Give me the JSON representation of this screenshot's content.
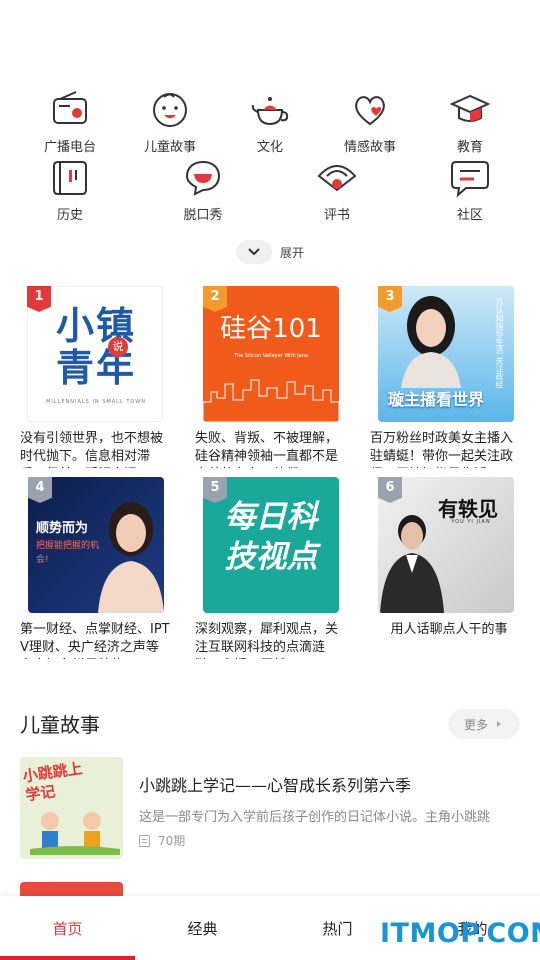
{
  "categories": [
    {
      "label": "广播电台",
      "icon": "radio-icon"
    },
    {
      "label": "儿童故事",
      "icon": "child-face-icon"
    },
    {
      "label": "文化",
      "icon": "teapot-icon"
    },
    {
      "label": "情感故事",
      "icon": "heart-icon"
    },
    {
      "label": "教育",
      "icon": "graduation-cap-icon"
    },
    {
      "label": "历史",
      "icon": "scroll-icon"
    },
    {
      "label": "脱口秀",
      "icon": "speech-bubble-icon"
    },
    {
      "label": "评书",
      "icon": "fan-icon"
    },
    {
      "label": "社区",
      "icon": "message-icon"
    }
  ],
  "expand_label": "展开",
  "cards": [
    {
      "rank": "1",
      "title": "没有引领世界，也不想被时代抛下。信息相对滞后，但并不孤陋寡闻。",
      "cover_text": "小镇青年",
      "cover_stamp": "说",
      "cover_sub": "MILLENNIALS IN SMALL TOWN"
    },
    {
      "rank": "2",
      "title": "失败、背叛、不被理解，硅谷精神领袖一直都不是完美的存在；他们",
      "cover_text": "硅谷101",
      "cover_sub": "The Silicon Valleyer With Jane"
    },
    {
      "rank": "3",
      "title": "百万粉丝时政美女主播入驻蜻蜓！带你一起关注政经，用认知指导生活",
      "cover_text": "璇主播看世界",
      "cover_side": "月认知指导生活 关注政经"
    },
    {
      "rank": "4",
      "title": "第一财经、点掌财经、IPTV理财、央广经济之声等多家知名栏目特约",
      "cover_text": "顺势而为",
      "cover_sub": "把握能把握的机会!"
    },
    {
      "rank": "5",
      "title": "深刻观察，犀利观点，关注互联网科技的点滴涟漪。主播：臣然",
      "cover_text": "每日科技视点"
    },
    {
      "rank": "6",
      "title": "用人话聊点人干的事",
      "cover_text": "有轶见",
      "cover_sub": "YOU YI JIAN"
    }
  ],
  "section": {
    "title": "儿童故事",
    "more_label": "更多",
    "item": {
      "title": "小跳跳上学记——心智成长系列第六季",
      "desc": "这是一部专门为入学前后孩子创作的日记体小说。主角小跳跳",
      "count": "70期",
      "cover_text": "小跳跳上学记"
    }
  },
  "nav": [
    {
      "label": "首页",
      "active": true
    },
    {
      "label": "经典",
      "active": false
    },
    {
      "label": "热门",
      "active": false
    },
    {
      "label": "我的",
      "active": false
    }
  ],
  "watermark": "ITMOP.COM",
  "colors": {
    "accent": "#e23a3a",
    "watermark": "#1b94d6"
  }
}
